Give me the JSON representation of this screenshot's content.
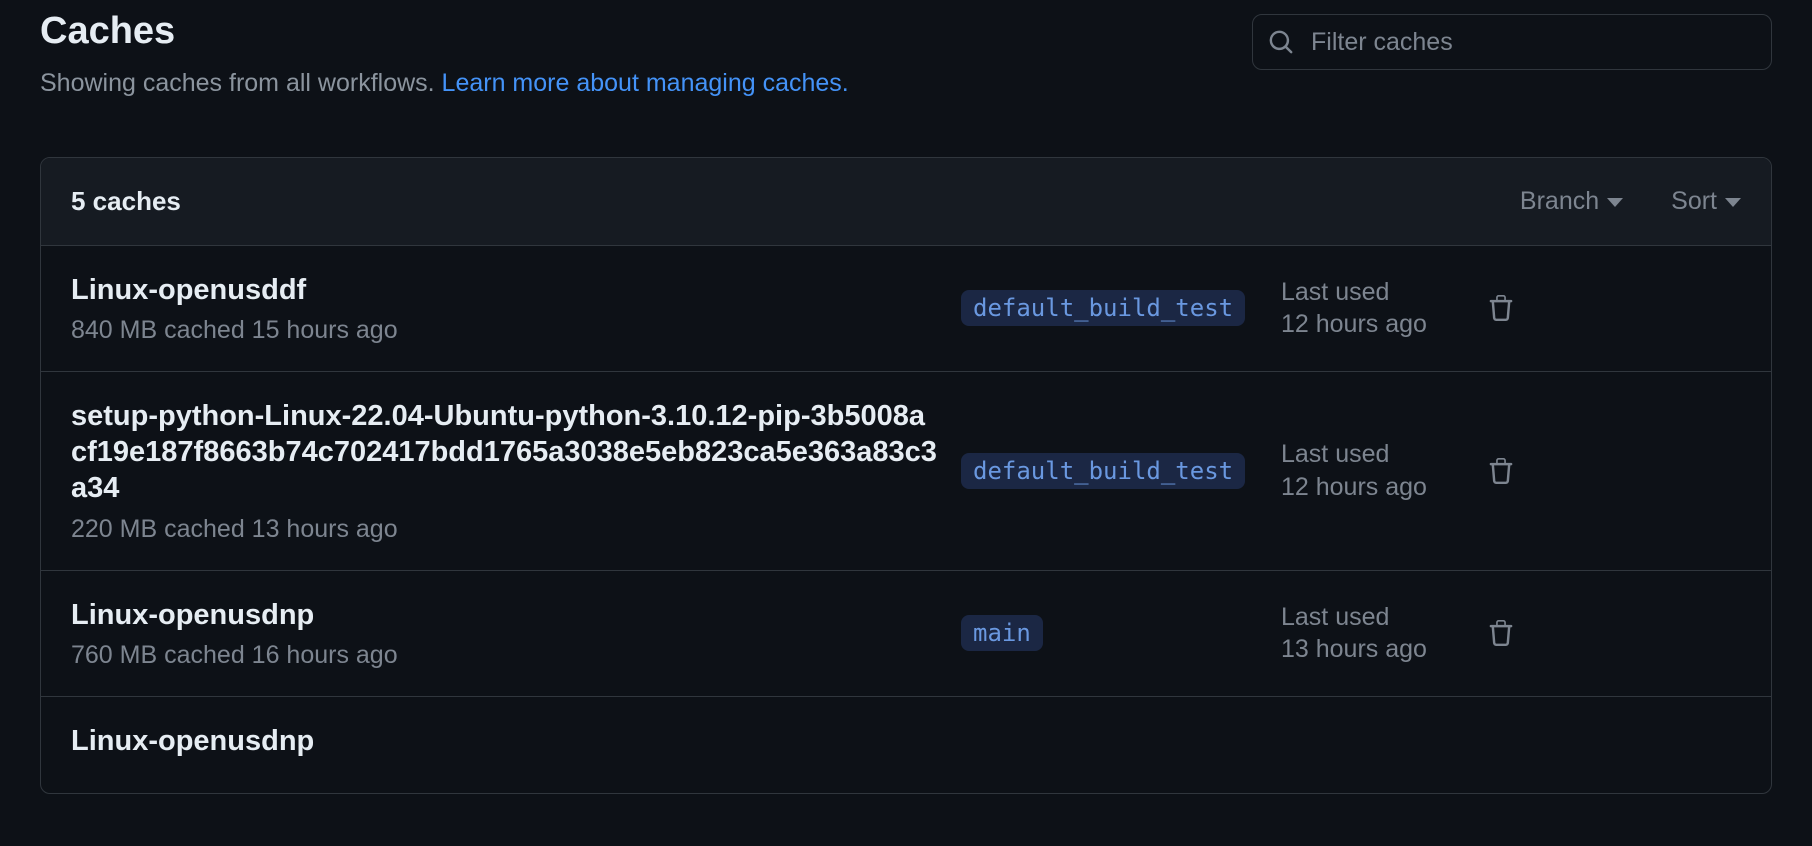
{
  "header": {
    "title": "Caches",
    "subtitle_prefix": "Showing caches from all workflows. ",
    "learn_more": "Learn more about managing caches."
  },
  "search": {
    "placeholder": "Filter caches"
  },
  "panel": {
    "count_label": "5 caches",
    "branch_filter_label": "Branch",
    "sort_filter_label": "Sort",
    "last_used_label": "Last used"
  },
  "caches": [
    {
      "name": "Linux-openusddf",
      "meta": "840 MB cached 15 hours ago",
      "branch": "default_build_test",
      "last_used": "12 hours ago"
    },
    {
      "name": "setup-python-Linux-22.04-Ubuntu-python-3.10.12-pip-3b5008acf19e187f8663b74c702417bdd1765a3038e5eb823ca5e363a83c3a34",
      "meta": "220 MB cached 13 hours ago",
      "branch": "default_build_test",
      "last_used": "12 hours ago"
    },
    {
      "name": "Linux-openusdnp",
      "meta": "760 MB cached 16 hours ago",
      "branch": "main",
      "last_used": "13 hours ago"
    },
    {
      "name": "Linux-openusdnp",
      "meta": "",
      "branch": "",
      "last_used": ""
    }
  ]
}
